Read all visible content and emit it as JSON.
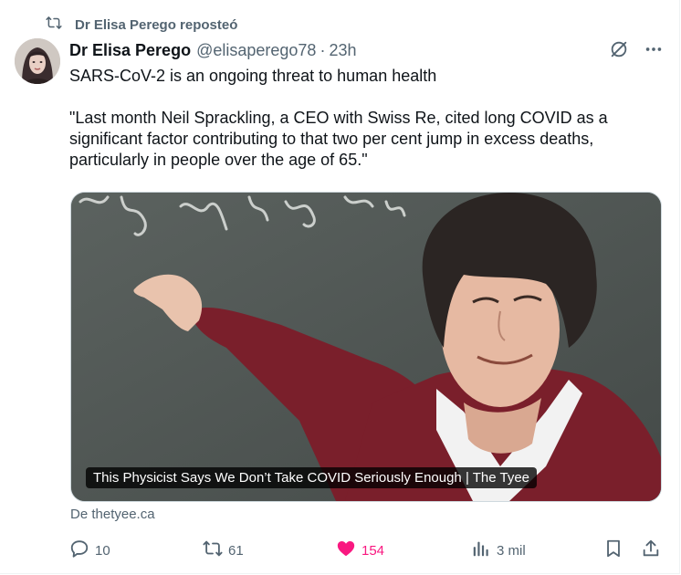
{
  "repost_banner": {
    "icon": "repost-icon",
    "text": "Dr Elisa Perego reposteó"
  },
  "post": {
    "author_name": "Dr Elisa Perego",
    "handle": "@elisaperego78",
    "separator": "·",
    "time": "23h",
    "text_line1": "SARS-CoV-2 is an ongoing threat to human health",
    "text_quote": "\"Last month Neil Sprackling, a CEO with Swiss Re, cited long COVID as a significant factor contributing to that two per cent jump in excess deaths, particularly in people over the age of 65.\"",
    "link_card": {
      "caption": "This Physicist Says We Don’t Take COVID Seriously Enough | The Tyee",
      "source": "De thetyee.ca"
    },
    "metrics": {
      "replies": "10",
      "reposts": "61",
      "likes": "154",
      "views": "3 mil"
    }
  },
  "colors": {
    "text": "#0f1419",
    "muted": "#536471",
    "like": "#f91880",
    "border": "#cfd9de"
  }
}
